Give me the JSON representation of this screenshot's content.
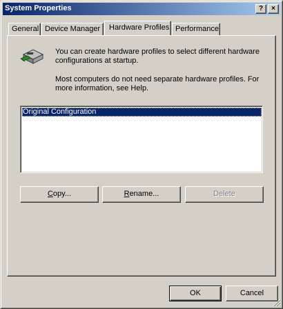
{
  "window": {
    "title": "System Properties",
    "help_button": "?",
    "close_button": "×"
  },
  "tabs": [
    {
      "label": "General",
      "active": false
    },
    {
      "label": "Device Manager",
      "active": false
    },
    {
      "label": "Hardware Profiles",
      "active": true
    },
    {
      "label": "Performance",
      "active": false
    }
  ],
  "panel": {
    "icon": "hardware-profile-icon",
    "description_1": "You can create hardware profiles to select different hardware configurations at startup.",
    "description_2": "Most computers do not need separate hardware profiles. For more information, see Help.",
    "profiles": [
      {
        "name": "Original Configuration",
        "selected": true
      }
    ],
    "buttons": {
      "copy_mnemonic": "C",
      "copy_rest": "opy...",
      "rename_mnemonic": "R",
      "rename_rest": "ename...",
      "delete_label": "Delete",
      "delete_enabled": false
    }
  },
  "footer": {
    "ok_label": "OK",
    "cancel_label": "Cancel"
  },
  "colors": {
    "face": "#d4d0c8",
    "title_start": "#0a246a",
    "title_end": "#a6caf0",
    "selection": "#0a246a"
  }
}
